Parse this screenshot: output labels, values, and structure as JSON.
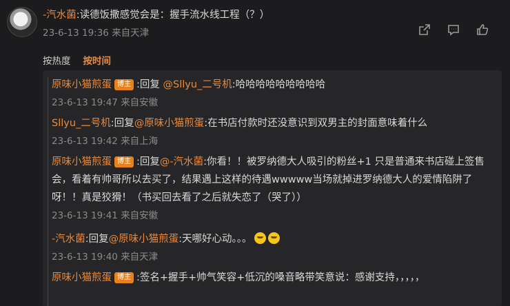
{
  "top_comment": {
    "author": "-汽水菌",
    "text": ":读德饭撒感觉会是：握手流水线工程（？）",
    "time": "23-6-13 19:36",
    "location": "来自天津"
  },
  "actions": {
    "share_icon": "share-icon",
    "comment_icon": "comment-icon",
    "like_icon": "like-icon"
  },
  "sort": {
    "hot": "按热度",
    "time": "按时间"
  },
  "replies": [
    {
      "author": "原味小猫煎蛋",
      "badge": "博主",
      "prefix": ":回复 ",
      "mention": "@Sllyu_二号机",
      "text": ":哈哈哈哈哈哈哈哈哈",
      "time": "23-6-13 19:47",
      "location": "来自安徽"
    },
    {
      "author": "Sllyu_二号机",
      "prefix": ":回复",
      "mention": "@原味小猫煎蛋",
      "text": ":在书店付款时还没意识到双男主的封面意味着什么",
      "time": "23-6-13 19:42",
      "location": "来自上海"
    },
    {
      "author": "原味小猫煎蛋",
      "badge": "博主",
      "prefix": ":回复",
      "mention": "@-汽水菌",
      "text": ":你看！！被罗纳德大人吸引的粉丝+1 只是普通来书店碰上签售会，看着有帅哥所以去买了，结果遇上这样的待遇wwwww当场就掉进罗纳德大人的爱情陷阱了呀！！真是狡猾！（书买回去看了之后就失恋了（哭了））",
      "time": "23-6-13 19:41",
      "location": "来自安徽"
    },
    {
      "author": "-汽水菌",
      "prefix": ":回复",
      "mention": "@原味小猫煎蛋",
      "text": ":天哪好心动。。。",
      "emoji": "hugging-emoji",
      "time": "23-6-13 19:40",
      "location": "来自天津"
    },
    {
      "author": "原味小猫煎蛋",
      "badge": "博主",
      "text": ":签名+握手+帅气笑容+低沉的嗓音略带笑意说：感谢支持，，，，，"
    }
  ],
  "colors": {
    "accent": "#e98b3e",
    "badge": "#e8821e",
    "background": "#1c1c1e",
    "panel": "#262628"
  }
}
